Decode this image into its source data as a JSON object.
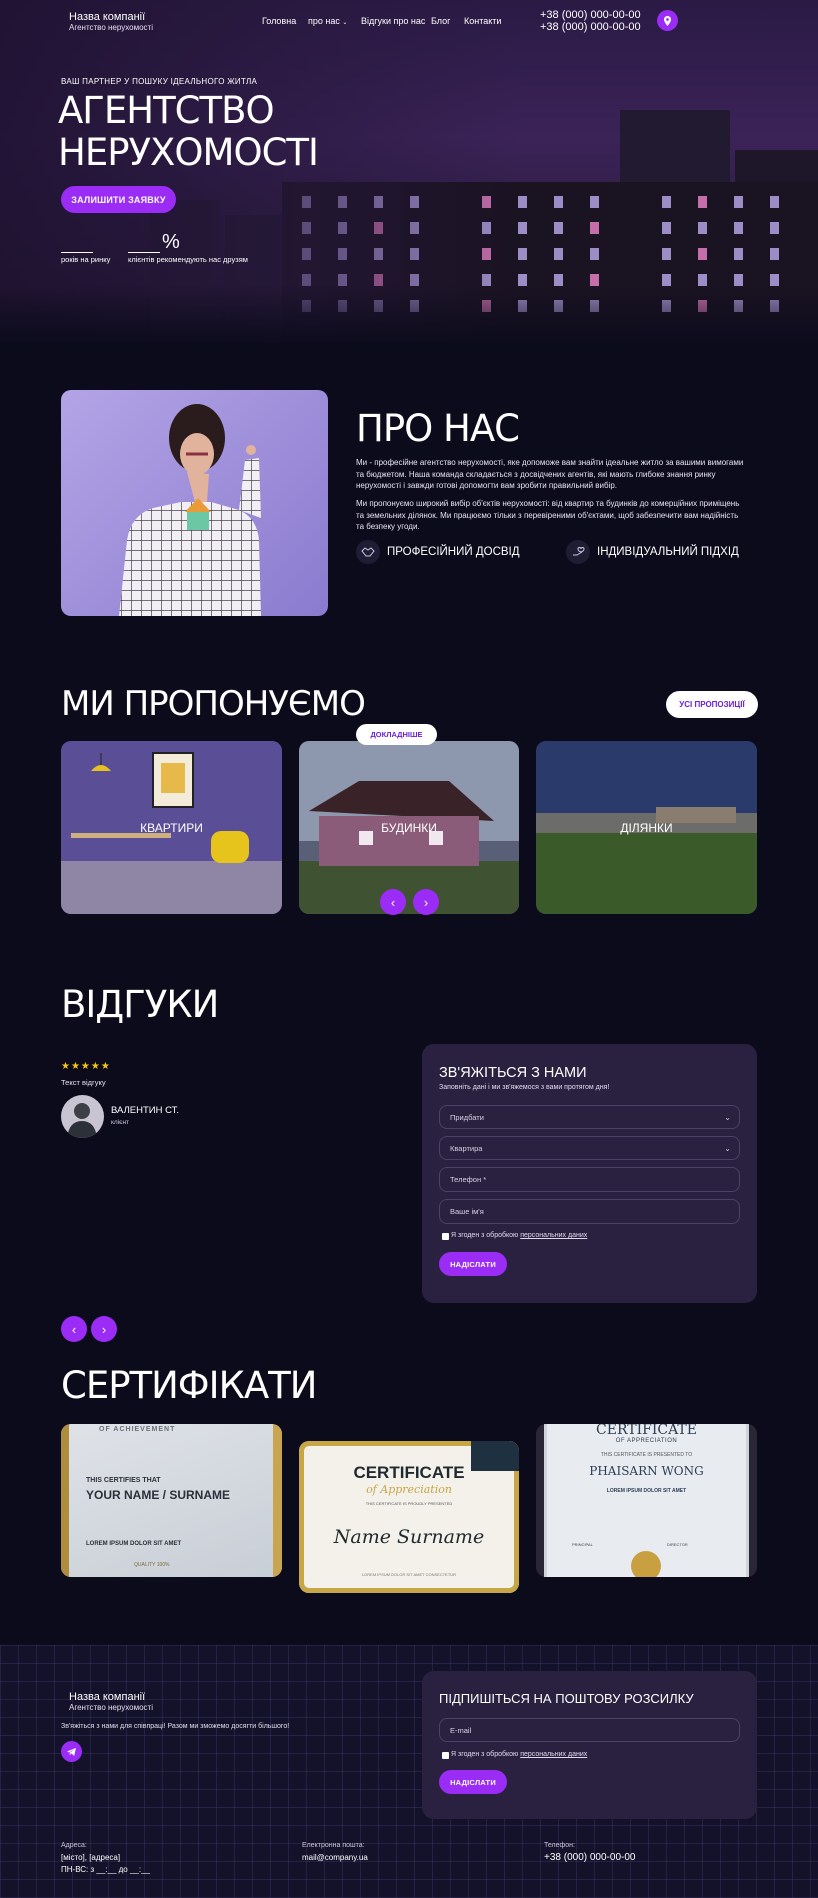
{
  "header": {
    "company_name": "Назва компанії",
    "company_sub": "Агентство нерухомості",
    "nav": [
      {
        "label": "Головна"
      },
      {
        "label": "про нас"
      },
      {
        "label": "Відгуки про нас"
      },
      {
        "label": "Блог"
      },
      {
        "label": "Контакти"
      }
    ],
    "phones": [
      "+38 (000) 000-00-00",
      "+38 (000) 000-00-00"
    ]
  },
  "hero": {
    "eyebrow": "ВАШ ПАРТНЕР У ПОШУКУ ІДЕАЛЬНОГО ЖИТЛА",
    "title_line1": "АГЕНТСТВО",
    "title_line2": "НЕРУХОМОСТІ",
    "cta": "ЗАЛИШИТИ ЗАЯВКУ",
    "stats": [
      {
        "value": "",
        "label": "років на ринку"
      },
      {
        "value": "%",
        "label": "клієнтів рекомендують нас друзям"
      }
    ]
  },
  "about": {
    "title": "ПРО НАС",
    "para1": "Ми - професійне агентство нерухомості, яке допоможе вам знайти ідеальне житло за вашими вимогами та бюджетом. Наша команда складається з досвідчених агентів, які мають глибоке знання ринку нерухомості і завжди готові допомогти вам зробити правильний вибір.",
    "para2": "Ми пропонуємо широкий вибір об'єктів нерухомості: від квартир та будинків до комерційних приміщень та земельних ділянок. Ми працюємо тільки з перевіреними об'єктами, щоб забезпечити вам надійність та безпеку угоди.",
    "features": [
      {
        "label": "ПРОФЕСІЙНИЙ ДОСВІД",
        "icon": "handshake-icon"
      },
      {
        "label": "ІНДИВІДУАЛЬНИЙ ПІДХІД",
        "icon": "hand-heart-icon"
      }
    ]
  },
  "offers": {
    "title": "МИ ПРОПОНУЄМО",
    "all_button": "УСІ ПРОПОЗИЦІЇ",
    "details_button": "ДОКЛАДНІШЕ",
    "cards": [
      {
        "label": "КВАРТИРИ"
      },
      {
        "label": "БУДИНКИ"
      },
      {
        "label": "ДІЛЯНКИ"
      }
    ]
  },
  "reviews": {
    "title": "ВІДГУКИ",
    "stars": "★★★★★",
    "text": "Текст відгуку",
    "name": "ВАЛЕНТИН СТ.",
    "role": "клієнт"
  },
  "contact_form": {
    "title": "ЗВ'ЯЖІТЬСЯ З НАМИ",
    "subtitle": "Заповніть дані і ми зв'яжемося з вами протягом дня!",
    "select1": "Придбати",
    "select2": "Квартира",
    "phone_placeholder": "Телефон *",
    "name_placeholder": "Ваше ім'я",
    "consent_prefix": "Я згоден з обробкою",
    "consent_link": "персональних даних",
    "submit": "НАДІСЛАТИ"
  },
  "certificates": {
    "title": "СЕРТИФІКАТИ",
    "items": [
      {
        "top": "OF ACHIEVEMENT",
        "line1": "THIS CERTIFIES THAT",
        "line2": "YOUR NAME / SURNAME",
        "line3": "LOREM IPSUM DOLOR SIT AMET",
        "badge": "QUALITY 100%"
      },
      {
        "top": "CERTIFICATE",
        "line1": "of Appreciation",
        "line2": "THIS CERTIFICATE IS PROUDLY PRESENTED",
        "line3": "Name Surname",
        "line4": "LOREM IPSUM DOLOR SIT AMET CONSECTETUR"
      },
      {
        "top": "CERTIFICATE",
        "line1": "OF APPRECIATION",
        "line2": "THIS CERTIFICATE IS PRESENTED TO",
        "line3": "PHAISARN WONG",
        "line4": "LOREM IPSUM DOLOR SIT AMET",
        "sig1": "PRINCIPAL",
        "sig2": "DIRECTOR"
      }
    ]
  },
  "footer": {
    "company_name": "Назва компанії",
    "company_sub": "Агентство нерухомості",
    "tagline": "Зв'яжіться з нами для співпраці! Разом ми зможемо досягти більшого!",
    "address_label": "Адреса:",
    "address_value": "[місто], [адреса]",
    "hours": "ПН-ВС: з __:__ до __:__",
    "email_label": "Електронна пошта:",
    "email_value": "mail@company.ua",
    "phone_label": "Телефон:",
    "phone_value": "+38 (000) 000-00-00"
  },
  "newsletter": {
    "title": "ПІДПИШІТЬСЯ НА ПОШТОВУ РОЗСИЛКУ",
    "email_placeholder": "E-mail",
    "consent_prefix": "Я згоден з обробкою",
    "consent_link": "персональних даних",
    "submit": "НАДІСЛАТИ"
  },
  "colors": {
    "accent": "#9a2cf5",
    "background": "#0c0b1c",
    "form_bg": "#2a2140"
  }
}
